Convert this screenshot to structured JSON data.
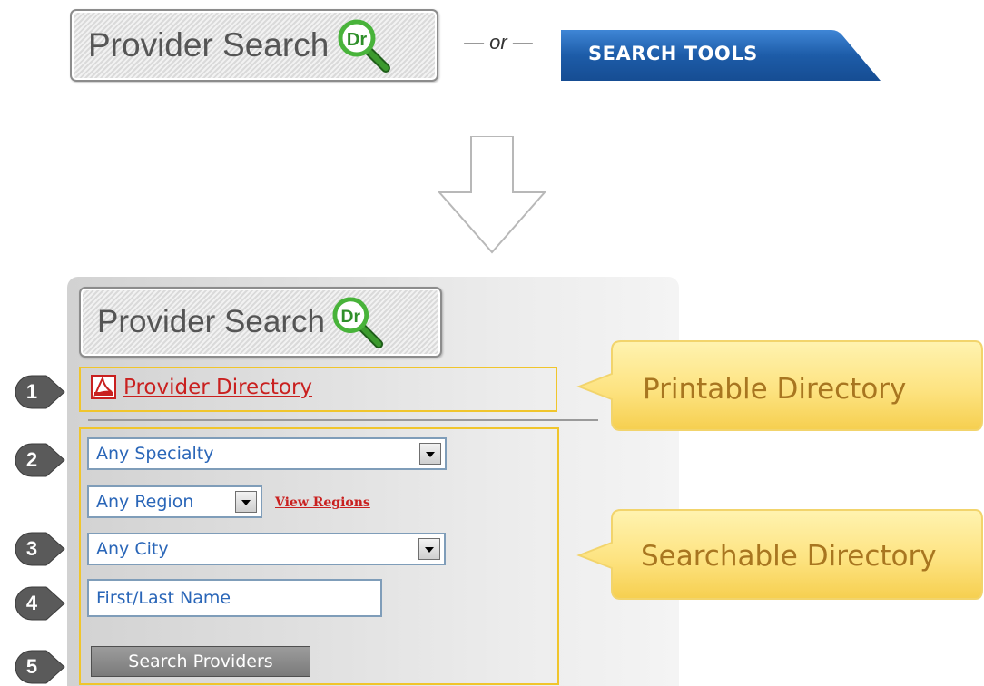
{
  "top": {
    "provider_search_button": {
      "label": "Provider Search",
      "icon": "magnifier-dr-icon",
      "icon_text": "Dr"
    },
    "or_text": "— or —",
    "search_tools_tab": {
      "label": "SEARCH TOOLS",
      "color": "#1d5ca8"
    }
  },
  "arrow": {
    "icon": "down-arrow-icon"
  },
  "panel": {
    "provider_search_button": {
      "label": "Provider Search",
      "icon": "magnifier-dr-icon",
      "icon_text": "Dr"
    },
    "directory_link": {
      "label": "Provider Directory",
      "icon": "pdf-icon"
    },
    "specialty_select": {
      "selected": "Any Specialty"
    },
    "region_select": {
      "selected": "Any Region"
    },
    "view_regions_link": "View Regions",
    "city_select": {
      "selected": "Any City"
    },
    "name_input": {
      "value": "",
      "placeholder": "First/Last Name"
    },
    "search_button": "Search Providers"
  },
  "markers": [
    "1",
    "2",
    "3",
    "4",
    "5"
  ],
  "callouts": {
    "printable": "Printable Directory",
    "searchable": "Searchable Directory"
  },
  "colors": {
    "marker": "#5a5a5a",
    "callout_fill": "#fde686",
    "callout_text": "#a87620",
    "highlight_border": "#f0c52c",
    "link_red": "#c9201f",
    "field_text": "#2a66b8"
  }
}
